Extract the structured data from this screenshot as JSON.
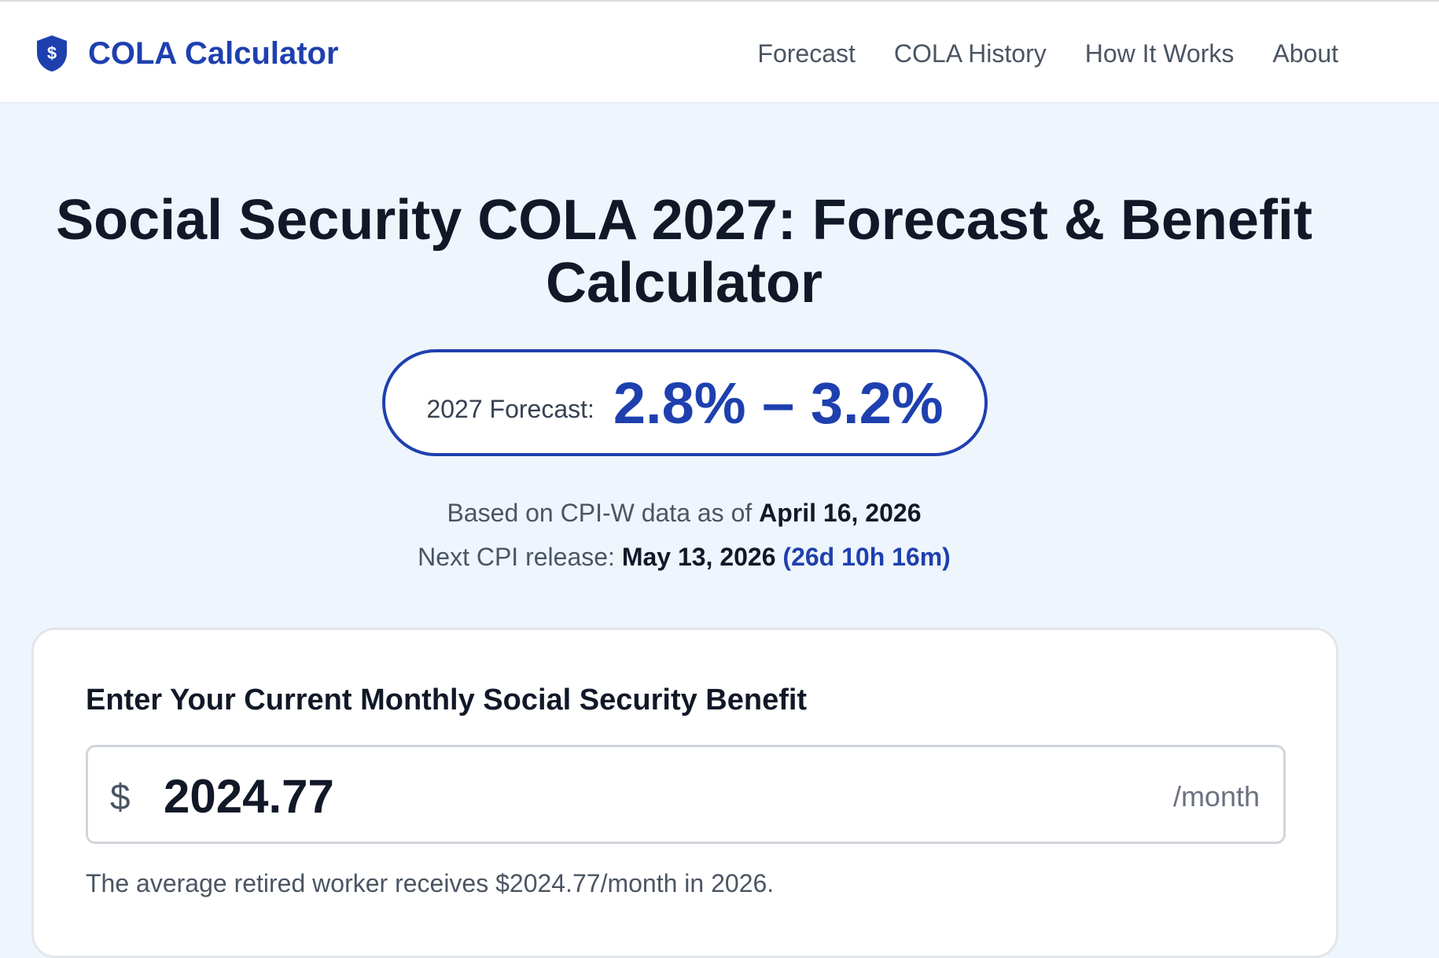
{
  "header": {
    "brand_name": "COLA Calculator",
    "brand_icon": "shield-dollar-icon",
    "nav": [
      "Forecast",
      "COLA History",
      "How It Works",
      "About"
    ]
  },
  "hero": {
    "title": "Social Security COLA 2027: Forecast & Benefit Calculator",
    "forecast_label": "2027 Forecast:",
    "forecast_range": "2.8% – 3.2%",
    "cpi_prefix": "Based on CPI-W data as of",
    "cpi_date": "April 16, 2026",
    "next_release_prefix": "Next CPI release:",
    "next_release_date": "May 13, 2026",
    "countdown": "(26d 10h 16m)"
  },
  "calculator": {
    "heading": "Enter Your Current Monthly Social Security Benefit",
    "currency_symbol": "$",
    "benefit_value": "2024.77",
    "unit_suffix": "/month",
    "hint": "The average retired worker receives $2024.77/month in 2026."
  },
  "colors": {
    "accent": "#1e40af",
    "page_background": "#eff5fd",
    "text_primary": "#111827",
    "text_muted": "#4b5563"
  }
}
